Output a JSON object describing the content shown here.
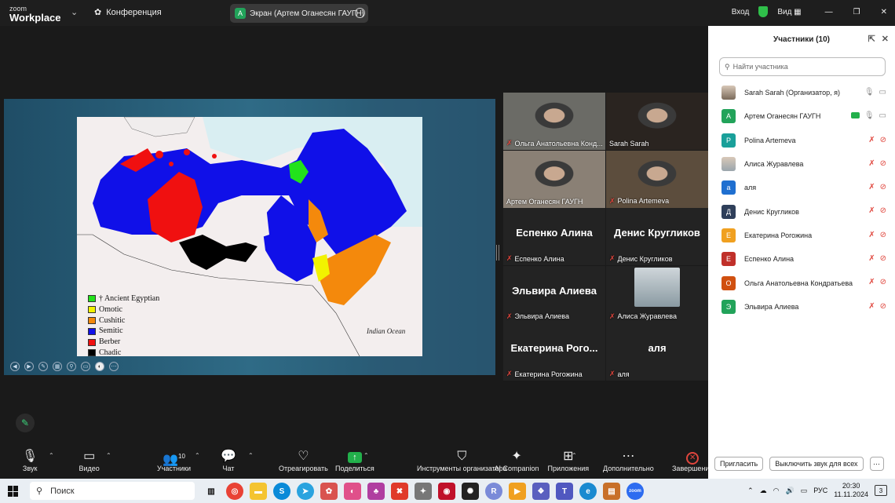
{
  "titlebar": {
    "logo_top": "zoom",
    "logo_bottom": "Workplace",
    "conference_label": "Конференция",
    "screen_pill": "Экран (Артем Оганесян ГАУГН)",
    "screen_pill_initial": "А",
    "login_label": "Вход",
    "view_label": "Вид"
  },
  "slide": {
    "ocean_label": "Indian Ocean",
    "legend": [
      {
        "label": "† Ancient Egyptian",
        "color": "#22e21b"
      },
      {
        "label": "Omotic",
        "color": "#f2f200"
      },
      {
        "label": "Cushitic",
        "color": "#f4890c"
      },
      {
        "label": "Semitic",
        "color": "#1010e8"
      },
      {
        "label": "Berber",
        "color": "#f01010"
      },
      {
        "label": "Chadic",
        "color": "#000000"
      }
    ]
  },
  "gallery": [
    {
      "name": "Ольга Анатольевна Конд...",
      "video": true,
      "mic_off": true,
      "bg": "#6b6b66"
    },
    {
      "name": "Sarah Sarah",
      "video": true,
      "mic_off": false,
      "bg": "#2a2420"
    },
    {
      "name": "Артем Оганесян ГАУГН",
      "video": true,
      "mic_off": false,
      "bg": "#8a8075",
      "active": true
    },
    {
      "name": "Polina Artemeva",
      "video": true,
      "mic_off": true,
      "bg": "#5c4d3d"
    },
    {
      "name": "Еспенко Алина",
      "big": "Еспенко Алина",
      "mic_off": true
    },
    {
      "name": "Денис Кругликов",
      "big": "Денис Кругликов",
      "mic_off": true
    },
    {
      "name": "Эльвира Алиева",
      "big": "Эльвира Алиева",
      "mic_off": true
    },
    {
      "name": "Алиса Журавлева",
      "thumb": true,
      "mic_off": true
    },
    {
      "name": "Екатерина Рогожина",
      "big": "Екатерина Рого...",
      "mic_off": true
    },
    {
      "name": "аля",
      "big": "аля",
      "mic_off": true
    }
  ],
  "toolbar": [
    {
      "label": "Звук",
      "icon": "🎙"
    },
    {
      "label": "Видео",
      "icon": "▭"
    },
    {
      "label": "Участники",
      "icon": "👥",
      "count": "10"
    },
    {
      "label": "Чат",
      "icon": "💬"
    },
    {
      "label": "Отреагировать",
      "icon": "♡"
    },
    {
      "label": "Поделиться",
      "icon": "↑"
    },
    {
      "label": "Инструменты организатора",
      "icon": "⛉"
    },
    {
      "label": "AI Companion",
      "icon": "✦"
    },
    {
      "label": "Приложения",
      "icon": "⊞"
    },
    {
      "label": "Дополнительно",
      "icon": "⋯"
    },
    {
      "label": "Завершение",
      "icon": "✕"
    }
  ],
  "panel": {
    "title": "Участники (10)",
    "search_placeholder": "Найти участника",
    "participants": [
      {
        "name": "Sarah Sarah (Организатор, я)",
        "initial": "",
        "color": "#7a6a5a",
        "muted": false,
        "photo": true
      },
      {
        "name": "Артем Оганесян ГАУГН",
        "initial": "А",
        "color": "#22a35a",
        "muted": false,
        "sharing": true
      },
      {
        "name": "Polina Artemeva",
        "initial": "P",
        "color": "#1aa09a",
        "muted": true
      },
      {
        "name": "Алиса Журавлева",
        "initial": "",
        "color": "#9aa6ad",
        "muted": true,
        "photo": true
      },
      {
        "name": "аля",
        "initial": "а",
        "color": "#1f6fd0",
        "muted": true
      },
      {
        "name": "Денис Кругликов",
        "initial": "Д",
        "color": "#2f3f5a",
        "muted": true
      },
      {
        "name": "Екатерина Рогожина",
        "initial": "Е",
        "color": "#f0a020",
        "muted": true
      },
      {
        "name": "Еспенко Алина",
        "initial": "Е",
        "color": "#c0302a",
        "muted": true
      },
      {
        "name": "Ольга Анатольевна Кондратьева",
        "initial": "О",
        "color": "#d05010",
        "muted": true
      },
      {
        "name": "Эльвира Алиева",
        "initial": "Э",
        "color": "#22a35a",
        "muted": true
      }
    ],
    "invite_label": "Пригласить",
    "mute_all_label": "Выключить звук для всех"
  },
  "taskbar": {
    "search_label": "Поиск",
    "lang": "РУС",
    "time": "20:30",
    "date": "11.11.2024",
    "notif_count": "3"
  }
}
